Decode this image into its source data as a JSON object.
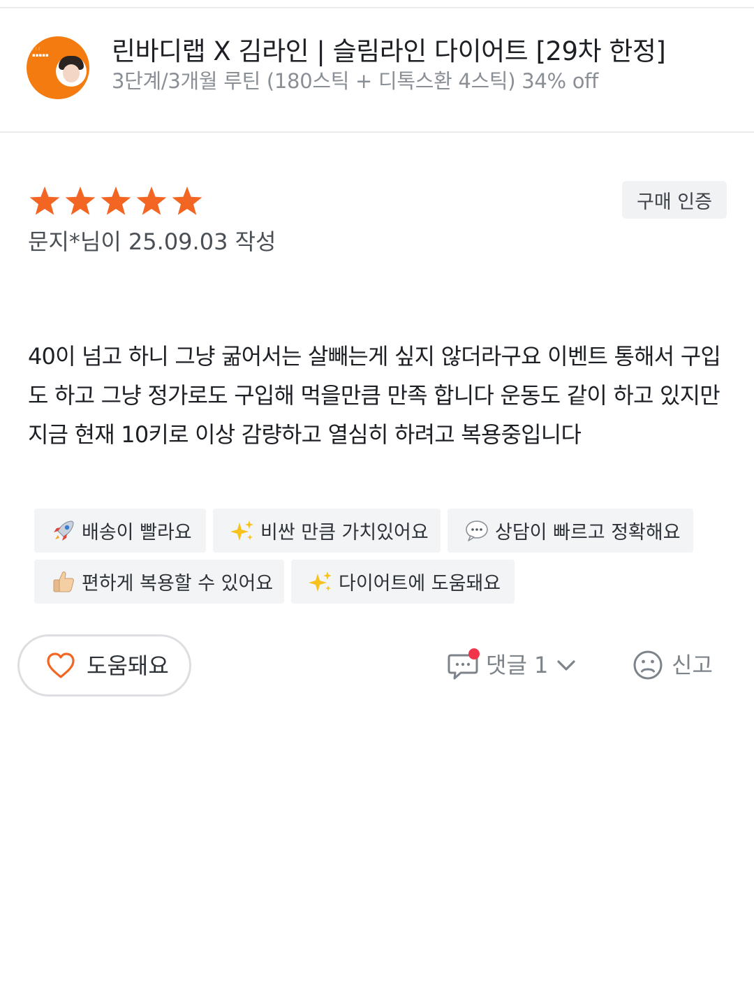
{
  "product": {
    "thumbnail_icon": "product-thumbnail",
    "title": "린바디랩 X 김라인 | 슬림라인 다이어트 [29차 한정]",
    "subtitle": "3단계/3개월 루틴 (180스틱 + 디톡스환 4스틱) 34% off"
  },
  "review": {
    "rating": 5,
    "rating_max": 5,
    "star_color": "#f26522",
    "verified_badge": "구매 인증",
    "author_line": "문지*님이 25.09.03 작성",
    "body": "40이 넘고 하니 그냥 굶어서는 살빼는게 싶지 않더라구요 이벤트 통해서 구입도 하고 그냥 정가로도 구입해 먹을만큼 만족 합니다 운동도 같이 하고 있지만 지금 현재 10키로 이상 감량하고 열심히 하려고 복용중입니다",
    "tags": [
      {
        "icon": "rocket-icon",
        "label": "배송이 빨라요"
      },
      {
        "icon": "sparkles-icon",
        "label": "비싼 만큼 가치있어요"
      },
      {
        "icon": "speech-bubble-icon",
        "label": "상담이 빠르고 정확해요"
      },
      {
        "icon": "thumbs-up-icon",
        "label": "편하게 복용할 수 있어요"
      },
      {
        "icon": "sparkles-icon",
        "label": "다이어트에 도움돼요"
      }
    ]
  },
  "actions": {
    "helpful_label": "도움돼요",
    "comments_label": "댓글 1",
    "comment_count": 1,
    "report_label": "신고",
    "accent_color": "#f26522",
    "notification_dot_color": "#f0344b"
  }
}
